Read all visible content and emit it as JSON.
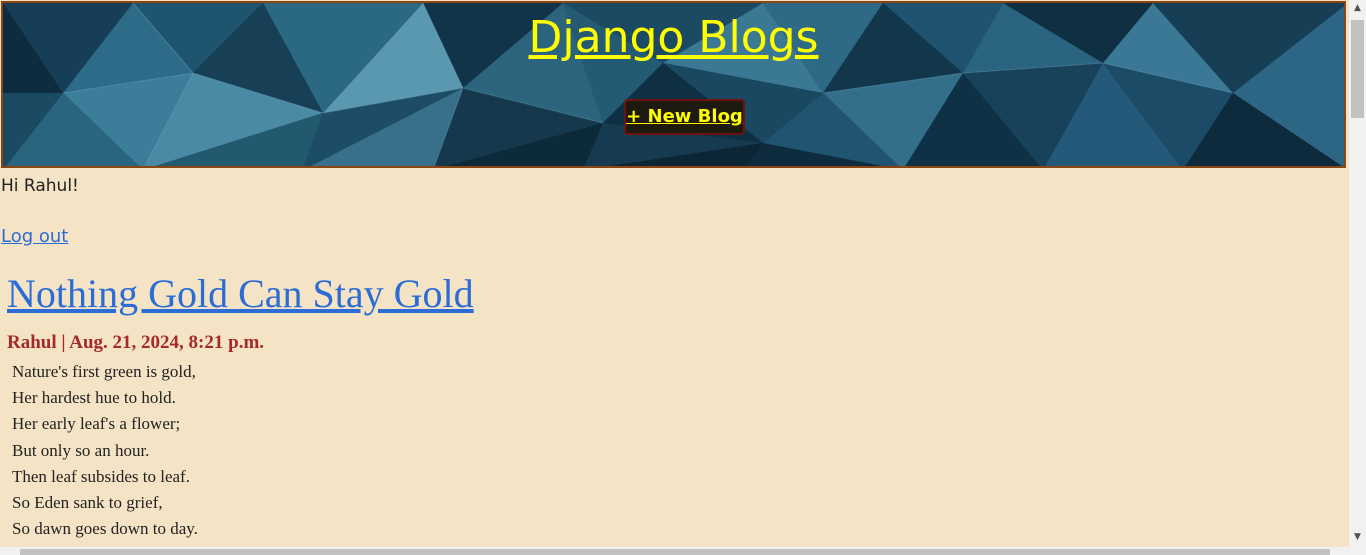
{
  "header": {
    "title": "Django Blogs",
    "new_blog_label": "+ New Blog",
    "title_color": "#ffff00",
    "banner_color": "#0f3246"
  },
  "user": {
    "greeting": "Hi Rahul!",
    "logout_label": "Log out"
  },
  "posts": [
    {
      "title": "Nothing Gold Can Stay Gold",
      "meta": "Rahul | Aug. 21, 2024, 8:21 p.m.",
      "lines": [
        "Nature's first green is gold,",
        "Her hardest hue to hold.",
        "Her early leaf's a flower;",
        "But only so an hour.",
        "Then leaf subsides to leaf.",
        "So Eden sank to grief,",
        "So dawn goes down to day."
      ]
    }
  ],
  "colors": {
    "page_background": "#f5e3c5",
    "link": "#2b6cd6",
    "meta": "#a52a2a",
    "border": "#8b4513"
  },
  "icons": {
    "scroll_up": "triangle-up",
    "scroll_down": "triangle-down"
  }
}
